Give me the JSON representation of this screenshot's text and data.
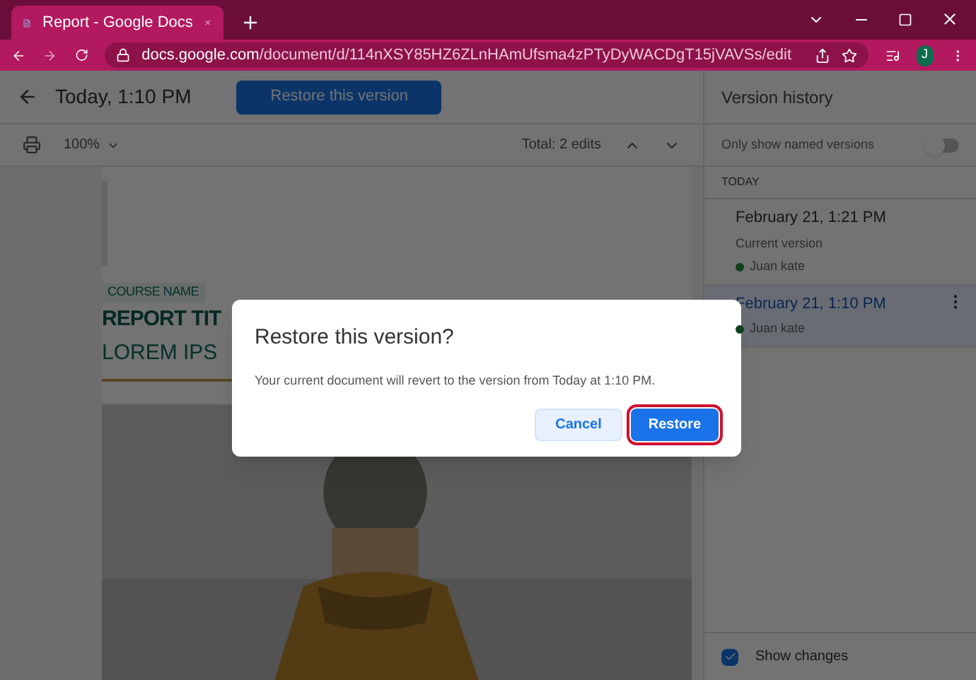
{
  "browser": {
    "tab_title": "Report - Google Docs",
    "url_host": "docs.google.com",
    "url_path": "/document/d/114nXSY85HZ6ZLnHAmUfsma4zPTyDyWACDgT15jVAVSs/edit",
    "profile_initial": "J"
  },
  "header": {
    "title": "Today, 1:10 PM",
    "restore_button": "Restore this version"
  },
  "toolbar": {
    "zoom": "100%",
    "total_edits": "Total: 2 edits"
  },
  "document": {
    "course_name": "COURSE NAME",
    "report_title": "REPORT TIT",
    "subtitle": "LOREM IPS"
  },
  "sidebar": {
    "title": "Version history",
    "named_only": {
      "label": "Only show named versions",
      "on": false
    },
    "section": "TODAY",
    "versions": [
      {
        "date": "February 21, 1:21 PM",
        "note": "Current version",
        "author": "Juan kate",
        "color": "#0e401c",
        "selected": false
      },
      {
        "date": "February 21, 1:10 PM",
        "author": "Juan kate",
        "color": "#0e401c",
        "selected": true
      }
    ],
    "show_changes": {
      "label": "Show changes",
      "checked": true
    }
  },
  "dialog": {
    "title": "Restore this version?",
    "message": "Your current document will revert to the version from Today at 1:10 PM.",
    "buttons": [
      {
        "label": "Cancel",
        "kind": "secondary"
      },
      {
        "label": "Restore",
        "kind": "primary"
      }
    ]
  }
}
